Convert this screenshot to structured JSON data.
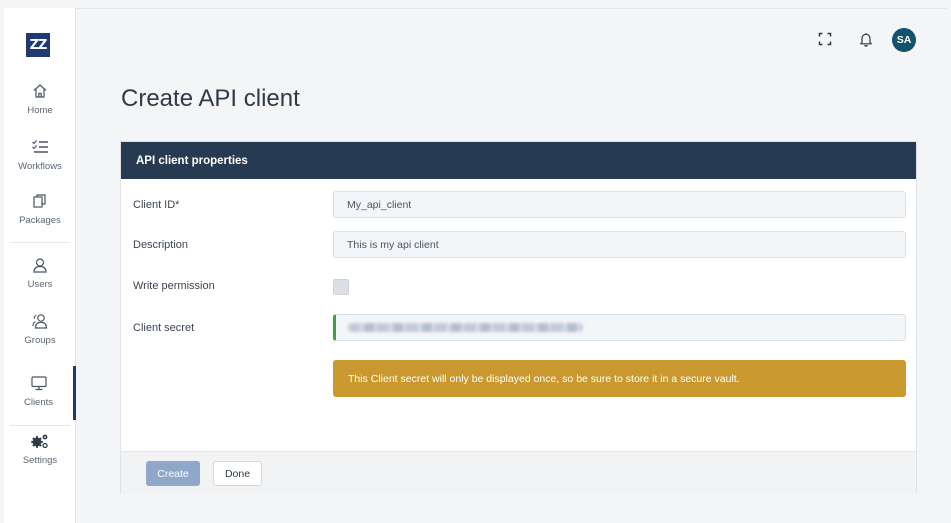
{
  "brand": {
    "logo_text": "ZZ"
  },
  "sidebar": {
    "items": [
      {
        "label": "Home",
        "icon": "home-icon"
      },
      {
        "label": "Workflows",
        "icon": "workflows-icon"
      },
      {
        "label": "Packages",
        "icon": "packages-icon"
      },
      {
        "label": "Users",
        "icon": "user-icon"
      },
      {
        "label": "Groups",
        "icon": "groups-icon"
      },
      {
        "label": "Clients",
        "icon": "monitor-icon"
      },
      {
        "label": "Settings",
        "icon": "gears-icon"
      }
    ],
    "active": "Clients"
  },
  "topbar": {
    "icons": [
      "fullscreen-icon",
      "bell-icon"
    ],
    "avatar_initials": "SA"
  },
  "page": {
    "title": "Create API client"
  },
  "form": {
    "header": "API client properties",
    "client_id_label": "Client ID*",
    "client_id_value": "My_api_client",
    "description_label": "Description",
    "description_value": "This is my api client",
    "write_permission_label": "Write permission",
    "write_permission_checked": false,
    "client_secret_label": "Client secret",
    "warning_text": "This Client secret will only be displayed once, so be sure to store it in a secure vault."
  },
  "footer": {
    "create_label": "Create",
    "done_label": "Done"
  },
  "colors": {
    "header_bg": "#263a52",
    "warning_bg": "#c9992f",
    "avatar_bg": "#15526c",
    "logo_bg": "#1f3a73",
    "create_btn": "#8fa8c9"
  }
}
